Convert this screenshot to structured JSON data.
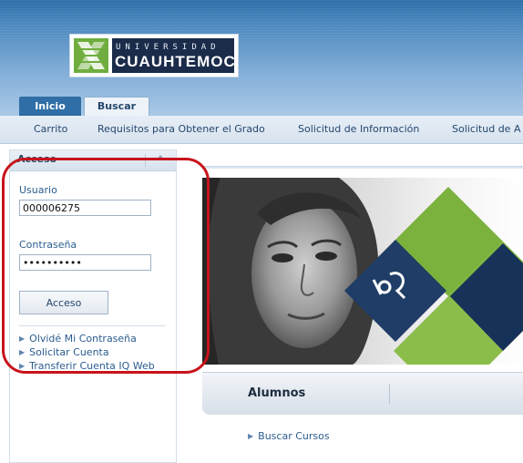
{
  "header": {
    "logo": {
      "top_text": "UNIVERSIDAD",
      "name": "CUAUHTEMOC"
    }
  },
  "tabs": [
    {
      "label": "Inicio",
      "active": true
    },
    {
      "label": "Buscar",
      "active": false
    }
  ],
  "nav": [
    "Carrito",
    "Requisitos para Obtener el Grado",
    "Solicitud de Información",
    "Solicitud de A"
  ],
  "login_panel": {
    "title": "Acceso",
    "username_label": "Usuario",
    "username_value": "000006275",
    "password_label": "Contraseña",
    "password_value": "••••••••••",
    "submit_label": "Acceso",
    "links": [
      "Olvidé Mi Contraseña",
      "Solicitar Cuenta",
      "Transferir Cuenta IQ Web"
    ]
  },
  "main": {
    "section_title": "Alumnos",
    "links": [
      "Buscar Cursos"
    ]
  },
  "colors": {
    "header_blue": "#2f6ea6",
    "logo_green": "#6fae3e",
    "logo_navy": "#1b2b4a",
    "link_blue": "#2b5d8f",
    "annotation_red": "#c8141c"
  }
}
